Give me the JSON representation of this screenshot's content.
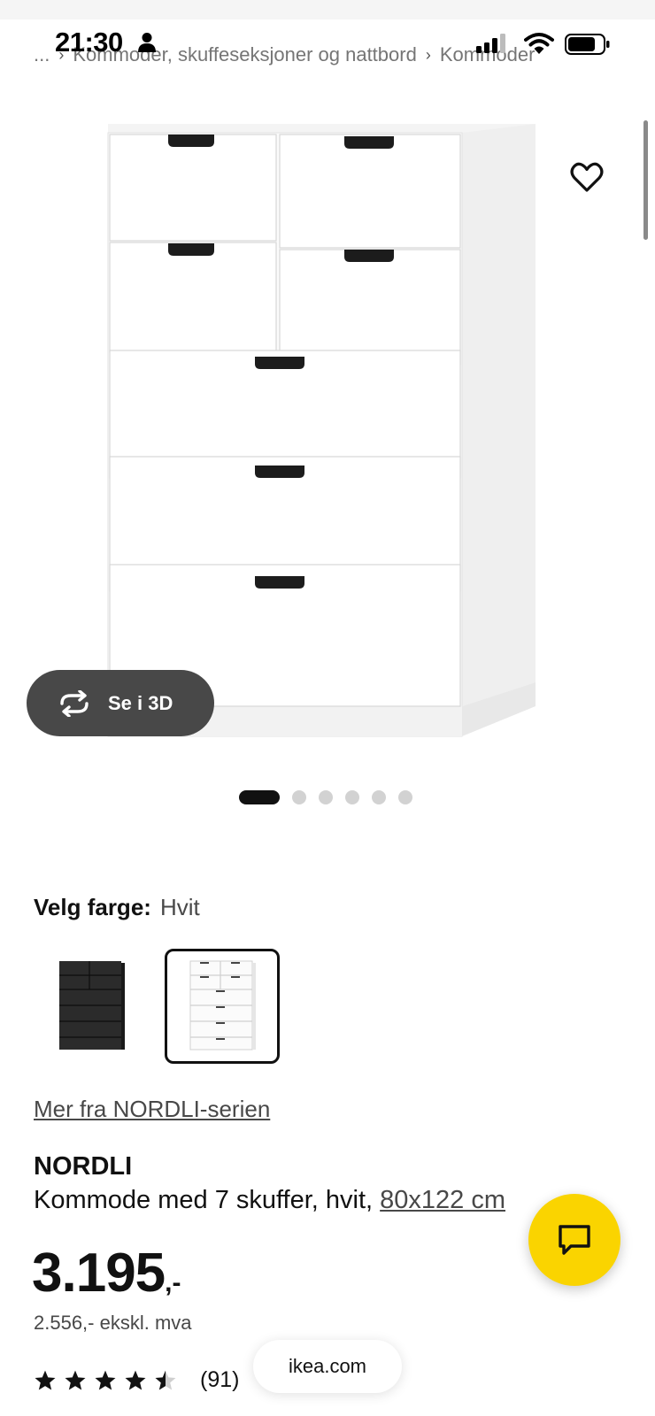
{
  "status_bar": {
    "time": "21:30"
  },
  "breadcrumb": {
    "ellipsis": "...",
    "items": [
      "Kommoder, skuffeseksjoner og nattbord",
      "Kommoder"
    ]
  },
  "gallery": {
    "view_3d_label": "Se i 3D",
    "image_count": 6,
    "active_index": 0
  },
  "color_picker": {
    "label": "Velg farge:",
    "selected": "Hvit",
    "options": [
      "svart",
      "hvit"
    ]
  },
  "series_link": "Mer fra NORDLI-serien",
  "product": {
    "name": "NORDLI",
    "description": "Kommode med 7 skuffer, hvit,",
    "size": "80x122 cm"
  },
  "price": {
    "integer": "3.195",
    "decimal": ",-",
    "ex_vat": "2.556,- ekskl. mva"
  },
  "rating": {
    "value": 4.5,
    "count": "(91)"
  },
  "browser": {
    "url": "ikea.com"
  },
  "colors": {
    "accent_yellow": "#fad400",
    "dark_button": "#484848",
    "text": "#111111"
  }
}
